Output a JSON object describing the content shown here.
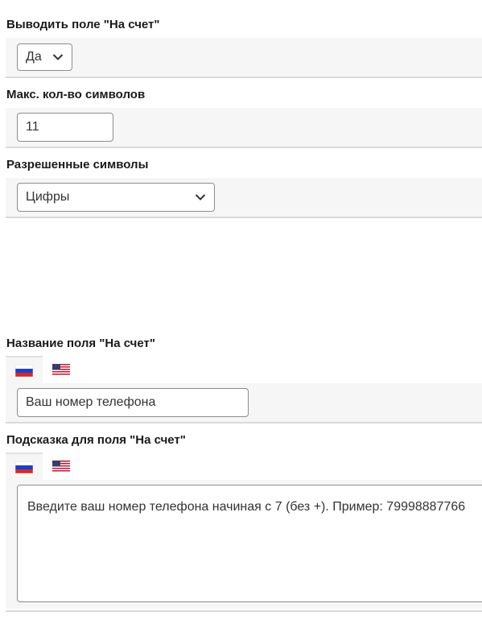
{
  "fields": {
    "show_field": {
      "label": "Выводить поле \"На счет\"",
      "value": "Да"
    },
    "max_chars": {
      "label": "Макс. кол-во символов",
      "value": "11"
    },
    "allowed_chars": {
      "label": "Разрешенные символы",
      "value": "Цифры"
    },
    "field_name": {
      "label": "Название поля \"На счет\"",
      "value": "Ваш номер телефона"
    },
    "field_hint": {
      "label": "Подсказка для поля \"На счет\"",
      "value": "Введите ваш номер телефона начиная с 7 (без +). Пример: 79998887766"
    }
  },
  "languages": [
    "ru-flag-icon",
    "us-flag-icon"
  ],
  "colors": {
    "band_background": "#f6f6f6",
    "divider": "#dadada",
    "control_border": "#8c8c8c"
  }
}
